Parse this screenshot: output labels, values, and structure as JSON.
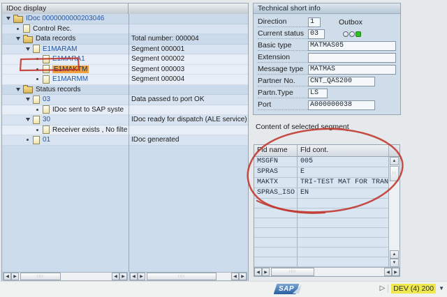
{
  "left_panel": {
    "title": "IDoc display",
    "tree": [
      {
        "label": "IDoc 0000000000203046",
        "detail": "",
        "level": 0,
        "bullet": "expander",
        "icon": "folder",
        "link": true,
        "shade": "mid"
      },
      {
        "label": "Control Rec.",
        "detail": "",
        "level": 1,
        "bullet": "dot",
        "icon": "doc",
        "link": false,
        "shade": "light"
      },
      {
        "label": "Data records",
        "detail": "Total number: 000004",
        "level": 1,
        "bullet": "expander",
        "icon": "folder",
        "link": false,
        "shade": "mid"
      },
      {
        "label": "E1MARAM",
        "detail": "Segment 000001",
        "level": 2,
        "bullet": "expander",
        "icon": "doc",
        "link": true,
        "shade": "light"
      },
      {
        "label": "E1MARA1",
        "detail": "Segment 000002",
        "level": 3,
        "bullet": "dot",
        "icon": "doc",
        "link": true,
        "shade": "lighter"
      },
      {
        "label": "E1MAKTM",
        "detail": "Segment 000003",
        "level": 3,
        "bullet": "dot",
        "icon": "doc",
        "link": true,
        "selected": true,
        "shade": "lighter"
      },
      {
        "label": "E1MARMM",
        "detail": "Segment 000004",
        "level": 3,
        "bullet": "dot",
        "icon": "doc",
        "link": true,
        "shade": "lighter"
      },
      {
        "label": "Status records",
        "detail": "",
        "level": 1,
        "bullet": "expander",
        "icon": "folder",
        "link": false,
        "shade": "mid"
      },
      {
        "label": "03",
        "detail": "Data passed to port OK",
        "level": 2,
        "bullet": "expander",
        "icon": "doc",
        "link": true,
        "shade": "light"
      },
      {
        "label": "IDoc sent to SAP syste",
        "detail": "",
        "level": 3,
        "bullet": "dot",
        "icon": "doc",
        "link": false,
        "shade": "lighter"
      },
      {
        "label": "30",
        "detail": "IDoc ready for dispatch (ALE service)",
        "level": 2,
        "bullet": "expander",
        "icon": "doc",
        "link": true,
        "shade": "light"
      },
      {
        "label": "Receiver exists , No filte",
        "detail": "",
        "level": 3,
        "bullet": "dot",
        "icon": "doc",
        "link": false,
        "shade": "lighter"
      },
      {
        "label": "01",
        "detail": "IDoc generated",
        "level": 2,
        "bullet": "dot",
        "icon": "doc",
        "link": true,
        "shade": "light"
      }
    ]
  },
  "tech_info": {
    "title": "Technical short info",
    "fields": [
      {
        "label": "Direction",
        "value": "1",
        "suffix": "Outbox"
      },
      {
        "label": "Current status",
        "value": "03",
        "traffic_light": true
      },
      {
        "label": "Basic type",
        "value": "MATMAS05"
      },
      {
        "label": "Extension",
        "value": ""
      },
      {
        "label": "Message type",
        "value": "MATMAS"
      },
      {
        "label": "Partner No.",
        "value": "CNT_QAS200"
      },
      {
        "label": "Partn.Type",
        "value": "LS"
      },
      {
        "label": "Port",
        "value": "A000000038"
      }
    ]
  },
  "segment_panel": {
    "title": "Content of selected segment",
    "columns": [
      "Fld name",
      "Fld cont."
    ],
    "rows": [
      {
        "name": "MSGFN",
        "content": "005"
      },
      {
        "name": "SPRAS",
        "content": "E"
      },
      {
        "name": "MAKTX",
        "content": "TRI-TEST MAT FOR TRANSFE"
      },
      {
        "name": "SPRAS_ISO",
        "content": "EN"
      }
    ],
    "empty_rows": 7
  },
  "status_bar": {
    "sap_logo": "SAP",
    "system_field": "DEV (4) 200"
  },
  "colors": {
    "annotation_red": "#c2372e",
    "selection_orange": "#f1a23e",
    "highlight_yellow": "#efe84e",
    "status_green": "#2fc11f",
    "link_blue": "#2456a4"
  }
}
